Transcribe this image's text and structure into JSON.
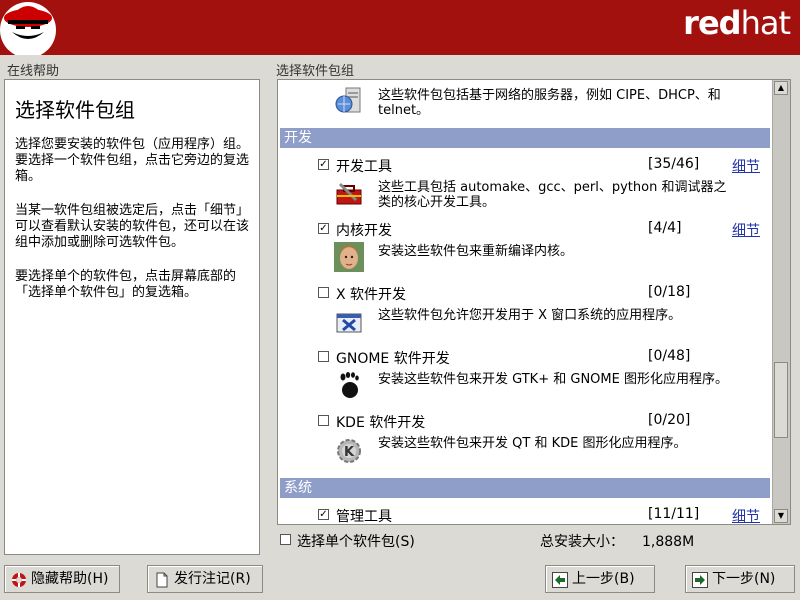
{
  "banner": {
    "brand_bold": "red",
    "brand_thin": "hat"
  },
  "help": {
    "frame_label": "在线帮助",
    "title": "选择软件包组",
    "paragraphs": [
      "选择您要安装的软件包（应用程序）组。要选择一个软件包组，点击它旁边的复选箱。",
      "当某一软件包组被选定后，点击「细节」可以查看默认安装的软件包，还可以在该组中添加或删除可选软件包。",
      "要选择单个的软件包，点击屏幕底部的「选择单个软件包」的复选箱。"
    ]
  },
  "packages": {
    "frame_label": "选择软件包组",
    "top_desc": "这些软件包包括基于网络的服务器，例如 CIPE、DHCP、和 telnet。",
    "categories": [
      {
        "name": "开发"
      },
      {
        "name": "系统"
      }
    ],
    "groups": [
      {
        "name": "开发工具",
        "checked": true,
        "check_mark": "✓",
        "count": "[35/46]",
        "detail": "细节",
        "desc": "这些工具包括 automake、gcc、perl、python 和调试器之类的核心开发工具。",
        "icon": "toolbox-icon"
      },
      {
        "name": "内核开发",
        "checked": true,
        "check_mark": "✓",
        "count": "[4/4]",
        "detail": "细节",
        "desc": "安装这些软件包来重新编译内核。",
        "icon": "linus-face-icon"
      },
      {
        "name": "X 软件开发",
        "checked": false,
        "check_mark": "",
        "count": "[0/18]",
        "detail": "",
        "desc": "这些软件包允许您开发用于 X 窗口系统的应用程序。",
        "icon": "x-window-icon"
      },
      {
        "name": "GNOME 软件开发",
        "checked": false,
        "check_mark": "",
        "count": "[0/48]",
        "detail": "",
        "desc": "安装这些软件包来开发 GTK+ 和 GNOME 图形化应用程序。",
        "icon": "gnome-foot-icon"
      },
      {
        "name": "KDE 软件开发",
        "checked": false,
        "check_mark": "",
        "count": "[0/20]",
        "detail": "",
        "desc": "安装这些软件包来开发 QT 和 KDE 图形化应用程序。",
        "icon": "kde-gear-icon"
      },
      {
        "name": "管理工具",
        "checked": true,
        "check_mark": "✓",
        "count": "[11/11]",
        "detail": "细节",
        "desc": "",
        "icon": ""
      }
    ]
  },
  "footer": {
    "individual_label": "选择单个软件包(S)",
    "total_label": "总安装大小：",
    "total_value": "1,888M"
  },
  "buttons": {
    "hide_help": "隐藏帮助(H)",
    "release_notes": "发行注记(R)",
    "back": "上一步(B)",
    "next": "下一步(N)"
  },
  "colors": {
    "banner": "#a3110f",
    "category_header": "#8f9dc9",
    "link": "#2233aa"
  }
}
